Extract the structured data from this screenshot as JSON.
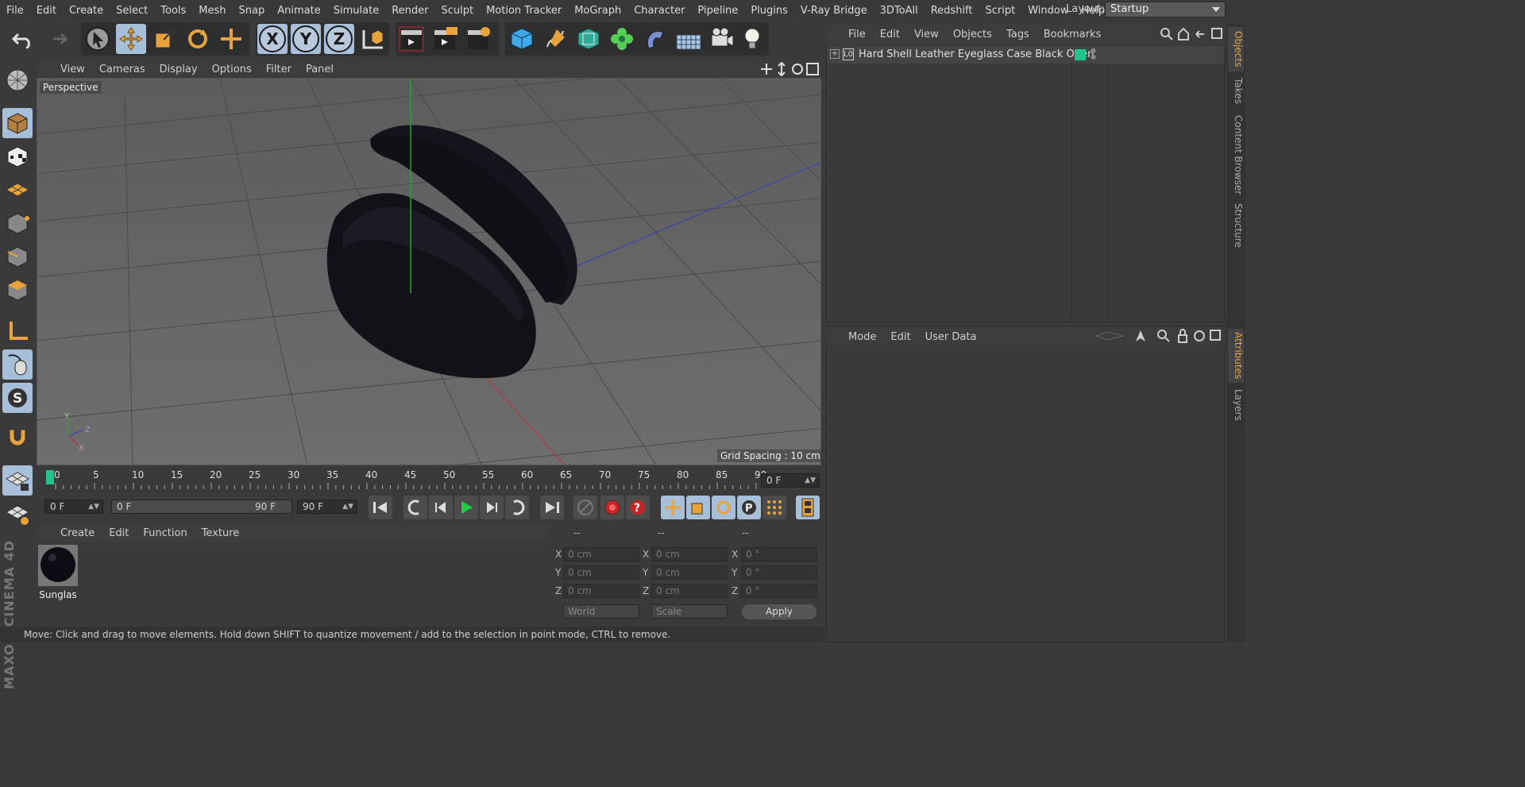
{
  "menubar": {
    "items": [
      "File",
      "Edit",
      "Create",
      "Select",
      "Tools",
      "Mesh",
      "Snap",
      "Animate",
      "Simulate",
      "Render",
      "Sculpt",
      "Motion Tracker",
      "MoGraph",
      "Character",
      "Pipeline",
      "Plugins",
      "V-Ray Bridge",
      "3DToAll",
      "Redshift",
      "Script",
      "Window",
      "Help"
    ],
    "layout_label": "Layout:",
    "layout_value": "Startup"
  },
  "toolbar": {
    "axis_x": "X",
    "axis_y": "Y",
    "axis_z": "Z"
  },
  "viewport": {
    "menu": [
      "View",
      "Cameras",
      "Display",
      "Options",
      "Filter",
      "Panel"
    ],
    "label": "Perspective",
    "grid_spacing": "Grid Spacing : 10 cm",
    "axis_y": "Y",
    "axis_z": "Z",
    "axis_x": "X"
  },
  "timeline": {
    "ticks": [
      "0",
      "5",
      "10",
      "15",
      "20",
      "25",
      "30",
      "35",
      "40",
      "45",
      "50",
      "55",
      "60",
      "65",
      "70",
      "75",
      "80",
      "85",
      "90"
    ],
    "current_frame": "0 F"
  },
  "transport": {
    "start_field": "0 F",
    "range_start": "0 F",
    "range_end": "90 F",
    "end_field": "90 F"
  },
  "materials": {
    "menu": [
      "Create",
      "Edit",
      "Function",
      "Texture"
    ],
    "items": [
      {
        "name": "Sunglas"
      }
    ]
  },
  "coordinates": {
    "headers": [
      "--",
      "--",
      "--"
    ],
    "pos": {
      "x": "0 cm",
      "y": "0 cm",
      "z": "0 cm"
    },
    "size": {
      "x": "0 cm",
      "y": "0 cm",
      "z": "0 cm"
    },
    "rot": {
      "x": "0 °",
      "y": "0 °",
      "z": "0 °"
    },
    "labels": {
      "x": "X",
      "y": "Y",
      "z": "Z"
    },
    "mode1": "World",
    "mode2": "Scale",
    "apply": "Apply"
  },
  "objects": {
    "menu": [
      "File",
      "Edit",
      "View",
      "Objects",
      "Tags",
      "Bookmarks"
    ],
    "rows": [
      {
        "name": "Hard Shell Leather Eyeglass Case Black Open"
      }
    ],
    "tag_color": "#22c48e"
  },
  "attributes": {
    "menu": [
      "Mode",
      "Edit",
      "User Data"
    ]
  },
  "right_tabs": [
    "Objects",
    "Takes",
    "Content Browser",
    "Structure",
    "Attributes",
    "Layers"
  ],
  "status": {
    "text": "Move: Click and drag to move elements. Hold down SHIFT to quantize movement / add to the selection in point mode, CTRL to remove."
  },
  "brand": {
    "text": "MAXON CINEMA 4D"
  },
  "colors": {
    "accent": "#e8a33c",
    "active_blue": "#a7bfd8",
    "axis_y": "#22aa22",
    "axis_x": "#c03030",
    "axis_z": "#3040c0"
  }
}
